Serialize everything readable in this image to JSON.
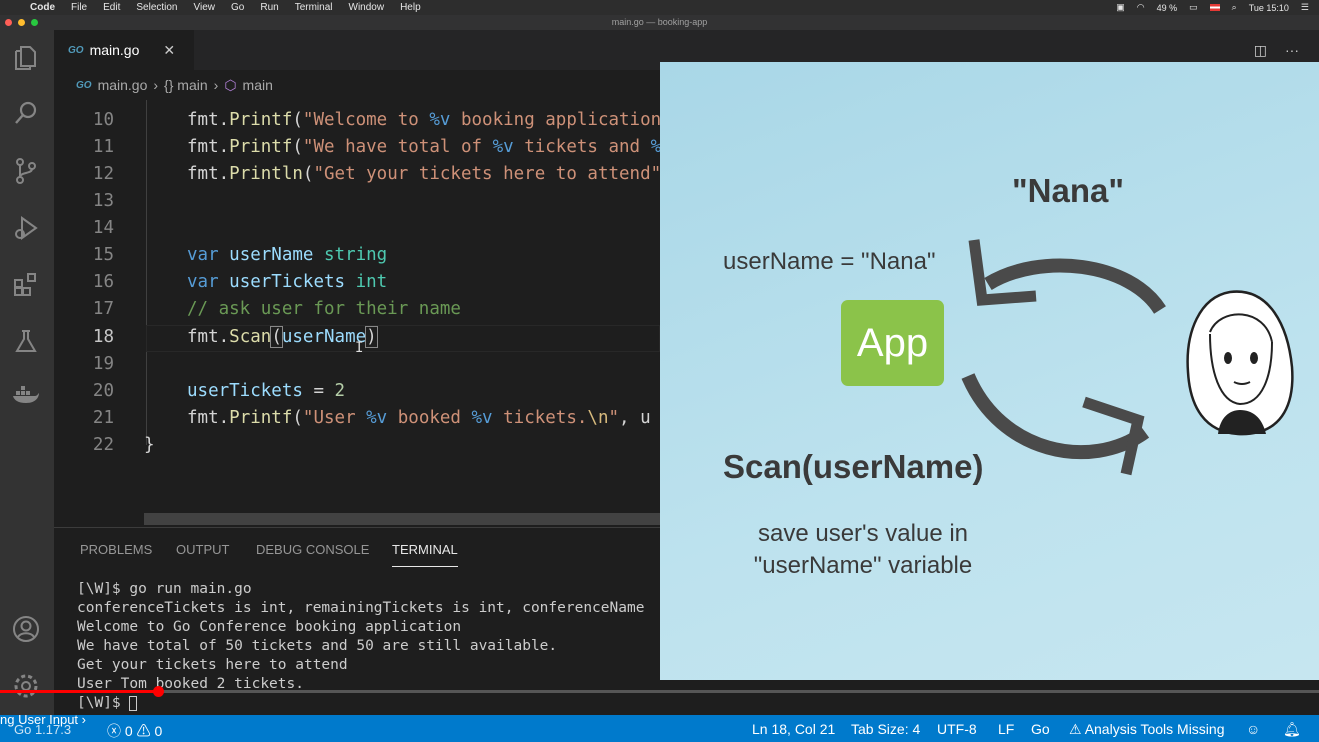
{
  "menubar": {
    "app": "Code",
    "items": [
      "File",
      "Edit",
      "Selection",
      "View",
      "Go",
      "Run",
      "Terminal",
      "Window",
      "Help"
    ],
    "battery": "49 %",
    "clock": "Tue 15:10"
  },
  "window": {
    "title": "main.go — booking-app"
  },
  "editor_tab": {
    "icon": "GO",
    "label": "main.go"
  },
  "breadcrumb": {
    "file": "main.go",
    "scope1": "{} main",
    "scope2": "main"
  },
  "code_lines": [
    {
      "num": "10"
    },
    {
      "num": "11"
    },
    {
      "num": "12"
    },
    {
      "num": "13"
    },
    {
      "num": "14"
    },
    {
      "num": "15"
    },
    {
      "num": "16"
    },
    {
      "num": "17"
    },
    {
      "num": "18"
    },
    {
      "num": "19"
    },
    {
      "num": "20"
    },
    {
      "num": "21"
    },
    {
      "num": "22"
    }
  ],
  "panel": {
    "tabs": [
      "PROBLEMS",
      "OUTPUT",
      "DEBUG CONSOLE",
      "TERMINAL"
    ],
    "active_tab": "TERMINAL",
    "terminal_lines": [
      "[\\W]$ go run main.go",
      "conferenceTickets is int, remainingTickets is int, conferenceName",
      "Welcome to Go Conference booking application",
      "We have total of 50 tickets and 50 are still available.",
      "Get your tickets here to attend",
      "User Tom booked 2 tickets.",
      "[\\W]$ "
    ]
  },
  "video_progress": 0.12,
  "statusbar": {
    "left_tooltip": "ng User Input",
    "go_version": "Go 1.17.3",
    "errors": "0",
    "warnings": "0",
    "position": "Ln 18, Col 21",
    "tab_size": "Tab Size: 4",
    "encoding": "UTF-8",
    "eol": "LF",
    "language": "Go",
    "analysis": "Analysis Tools Missing"
  },
  "slide": {
    "value_label": "\"Nana\"",
    "assignment": "userName = \"Nana\"",
    "app_label": "App",
    "scan_title": "Scan(userName)",
    "scan_desc_1": "save user's value in",
    "scan_desc_2": "\"userName\" variable"
  },
  "colors": {
    "accent": "#007acc",
    "app_green": "#8bc34a",
    "progress": "#ff0000"
  }
}
